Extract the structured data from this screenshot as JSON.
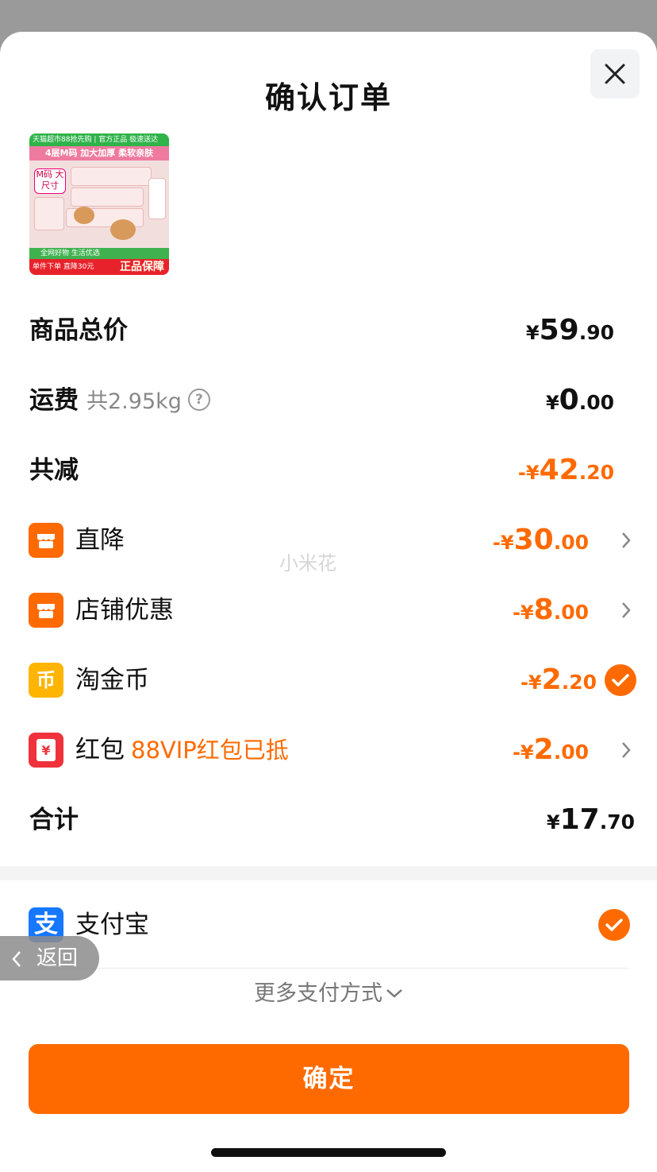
{
  "header": {
    "title": "确认订单"
  },
  "product": {
    "top_text": "天猫超市88抢先购 | 官方正品 极速送达",
    "headline": "4层M码 加大加厚 柔软亲肤",
    "tag": "M码 大尺寸",
    "green_text": "全网好物 生活优选",
    "red_text": "单件下单 直降30元",
    "red_badge": "正品保障"
  },
  "rows": {
    "goods_total": {
      "label": "商品总价",
      "currency": "¥",
      "int": "59",
      "dec": ".90"
    },
    "shipping": {
      "label": "运费",
      "sub": "共2.95kg",
      "help": "?",
      "currency": "¥",
      "int": "0",
      "dec": ".00"
    },
    "total_discount": {
      "label": "共减",
      "prefix": "-¥",
      "int": "42",
      "dec": ".20"
    },
    "direct_drop": {
      "label": "直降",
      "prefix": "-¥",
      "int": "30",
      "dec": ".00"
    },
    "shop_discount": {
      "label": "店铺优惠",
      "prefix": "-¥",
      "int": "8",
      "dec": ".00"
    },
    "coins": {
      "label": "淘金币",
      "prefix": "-¥",
      "int": "2",
      "dec": ".20",
      "icon_char": "币"
    },
    "redpacket": {
      "label": "红包",
      "sub": "88VIP红包已抵",
      "prefix": "-¥",
      "int": "2",
      "dec": ".00",
      "icon_char": "¥"
    },
    "sum": {
      "label": "合计",
      "currency": "¥",
      "int": "17",
      "dec": ".70"
    }
  },
  "payment": {
    "method_label": "支付宝",
    "icon_char": "支",
    "more_label": "更多支付方式"
  },
  "confirm_label": "确定",
  "back_label": "返回",
  "watermark": "小米花",
  "colors": {
    "accent": "#ff6a00",
    "alipay": "#1677ff",
    "coin": "#ffb400",
    "redpacket": "#f0323c"
  }
}
